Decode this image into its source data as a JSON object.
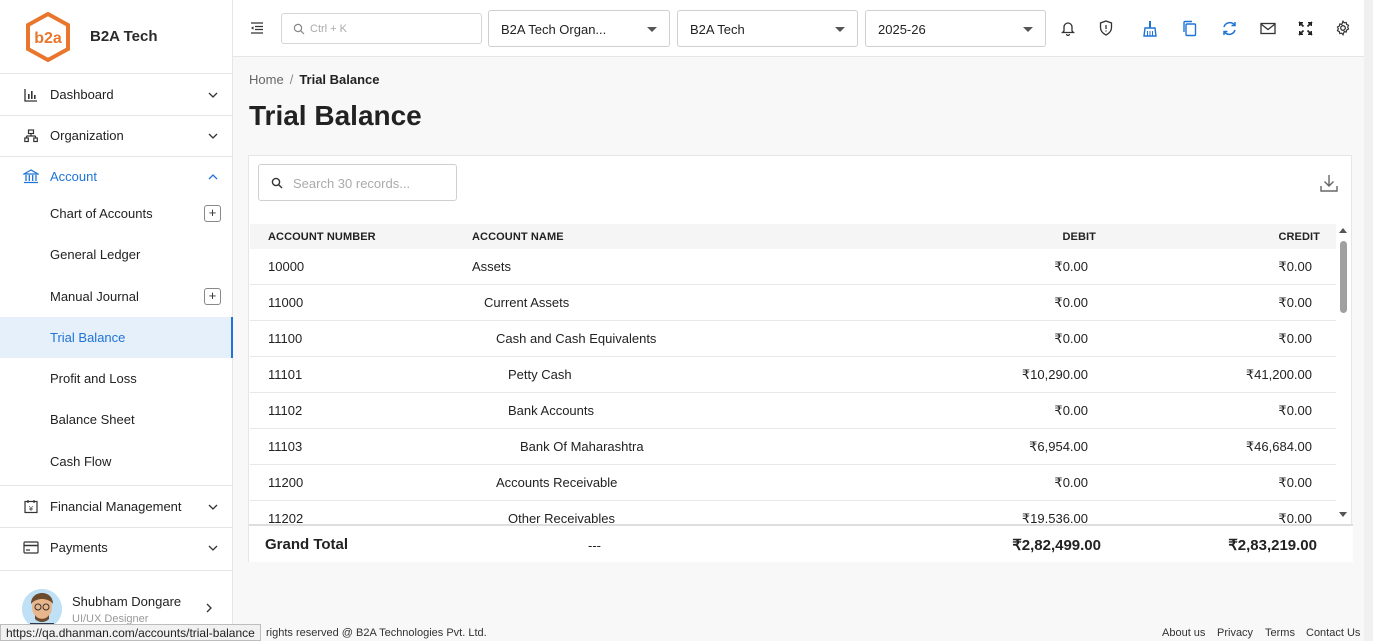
{
  "brand": {
    "name": "B2A Tech"
  },
  "sidebar": {
    "items": [
      {
        "label": "Dashboard",
        "icon": "bar-chart-icon"
      },
      {
        "label": "Organization",
        "icon": "org-chart-icon"
      },
      {
        "label": "Account",
        "icon": "bank-icon"
      },
      {
        "label": "Financial Management",
        "icon": "calendar-money-icon"
      },
      {
        "label": "Payments",
        "icon": "card-icon"
      }
    ],
    "account_sub": [
      {
        "label": "Chart of Accounts",
        "plus": "+"
      },
      {
        "label": "General Ledger"
      },
      {
        "label": "Manual Journal",
        "plus": "+"
      },
      {
        "label": "Trial Balance"
      },
      {
        "label": "Profit and Loss"
      },
      {
        "label": "Balance Sheet"
      },
      {
        "label": "Cash Flow"
      }
    ]
  },
  "user": {
    "name": "Shubham Dongare",
    "role": "UI/UX Designer"
  },
  "topbar": {
    "search_placeholder": "Ctrl + K",
    "org_select": "B2A Tech Organ...",
    "company_select": "B2A Tech",
    "year_select": "2025-26"
  },
  "breadcrumb": {
    "home": "Home",
    "separator": "/",
    "current": "Trial Balance"
  },
  "page": {
    "title": "Trial Balance"
  },
  "table": {
    "search_placeholder": "Search 30 records...",
    "headers": {
      "number": "ACCOUNT NUMBER",
      "name": "ACCOUNT NAME",
      "debit": "DEBIT",
      "credit": "CREDIT"
    },
    "rows": [
      {
        "number": "10000",
        "name": "Assets",
        "debit": "₹0.00",
        "credit": "₹0.00",
        "level": 0
      },
      {
        "number": "11000",
        "name": "Current Assets",
        "debit": "₹0.00",
        "credit": "₹0.00",
        "level": 1
      },
      {
        "number": "11100",
        "name": "Cash and Cash Equivalents",
        "debit": "₹0.00",
        "credit": "₹0.00",
        "level": 2
      },
      {
        "number": "11101",
        "name": "Petty Cash",
        "debit": "₹10,290.00",
        "credit": "₹41,200.00",
        "level": 3
      },
      {
        "number": "11102",
        "name": "Bank Accounts",
        "debit": "₹0.00",
        "credit": "₹0.00",
        "level": 3
      },
      {
        "number": "11103",
        "name": "Bank Of Maharashtra",
        "debit": "₹6,954.00",
        "credit": "₹46,684.00",
        "level": 4
      },
      {
        "number": "11200",
        "name": "Accounts Receivable",
        "debit": "₹0.00",
        "credit": "₹0.00",
        "level": 2
      },
      {
        "number": "11202",
        "name": "Other Receivables",
        "debit": "₹19,536.00",
        "credit": "₹0.00",
        "level": 3
      }
    ],
    "total": {
      "label": "Grand Total",
      "name": "---",
      "debit": "₹2,82,499.00",
      "credit": "₹2,83,219.00"
    }
  },
  "footer": {
    "copyright": "rights reserved @ B2A Technologies Pvt. Ltd.",
    "links": [
      "About us",
      "Privacy",
      "Terms",
      "Contact Us"
    ]
  },
  "status_url": "https://qa.dhanman.com/accounts/trial-balance",
  "colors": {
    "accent": "#1f74d6",
    "brand": "#e8762c"
  }
}
